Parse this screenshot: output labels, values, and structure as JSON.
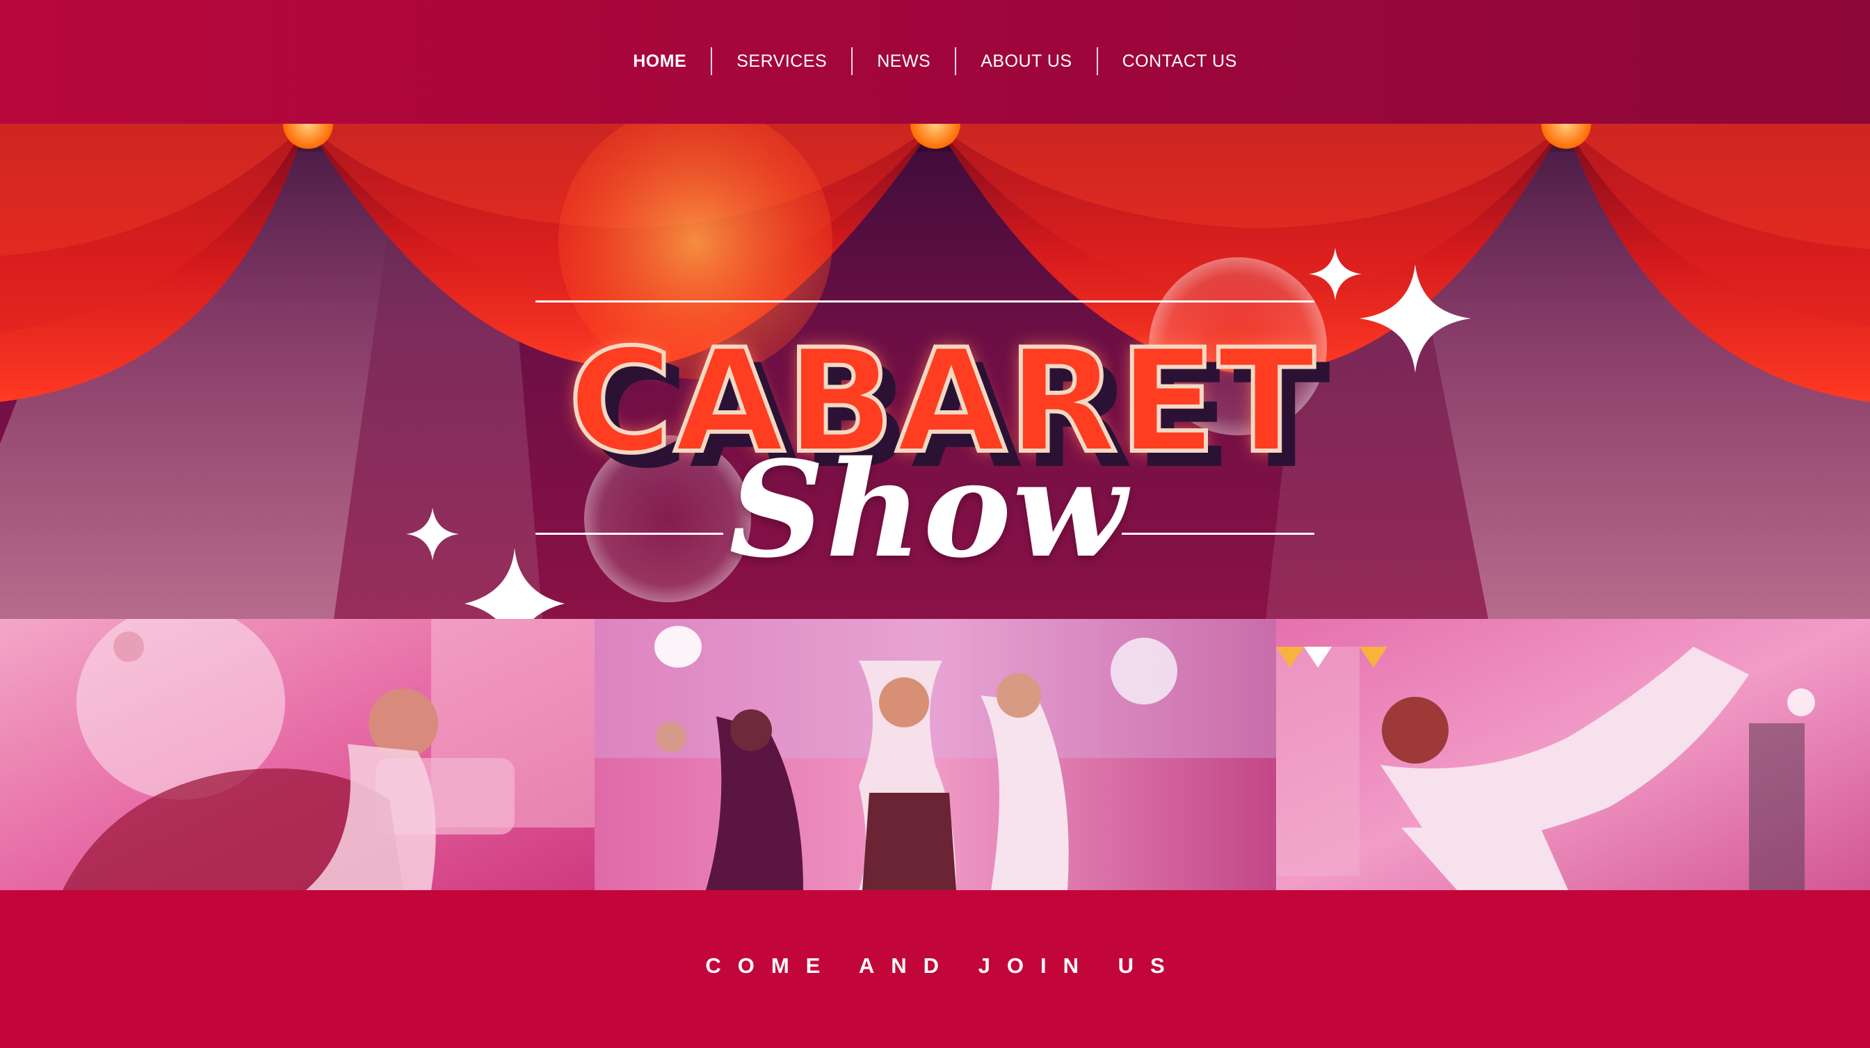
{
  "nav": {
    "items": [
      {
        "label": "HOME",
        "active": true
      },
      {
        "label": "SERVICES",
        "active": false
      },
      {
        "label": "NEWS",
        "active": false
      },
      {
        "label": "ABOUT US",
        "active": false
      },
      {
        "label": "CONTACT US",
        "active": false
      }
    ]
  },
  "hero": {
    "title": "CABARET",
    "subtitle": "Show"
  },
  "photos": [
    {
      "name": "dancer-photo-1"
    },
    {
      "name": "dancer-photo-2"
    },
    {
      "name": "dancer-photo-3"
    }
  ],
  "footer": {
    "cta": "COME AND JOIN US"
  },
  "colors": {
    "brand": "#c3063a",
    "curtain": "#ff2a1f",
    "title_fill": "#ff3d21",
    "text": "#ffffff"
  }
}
